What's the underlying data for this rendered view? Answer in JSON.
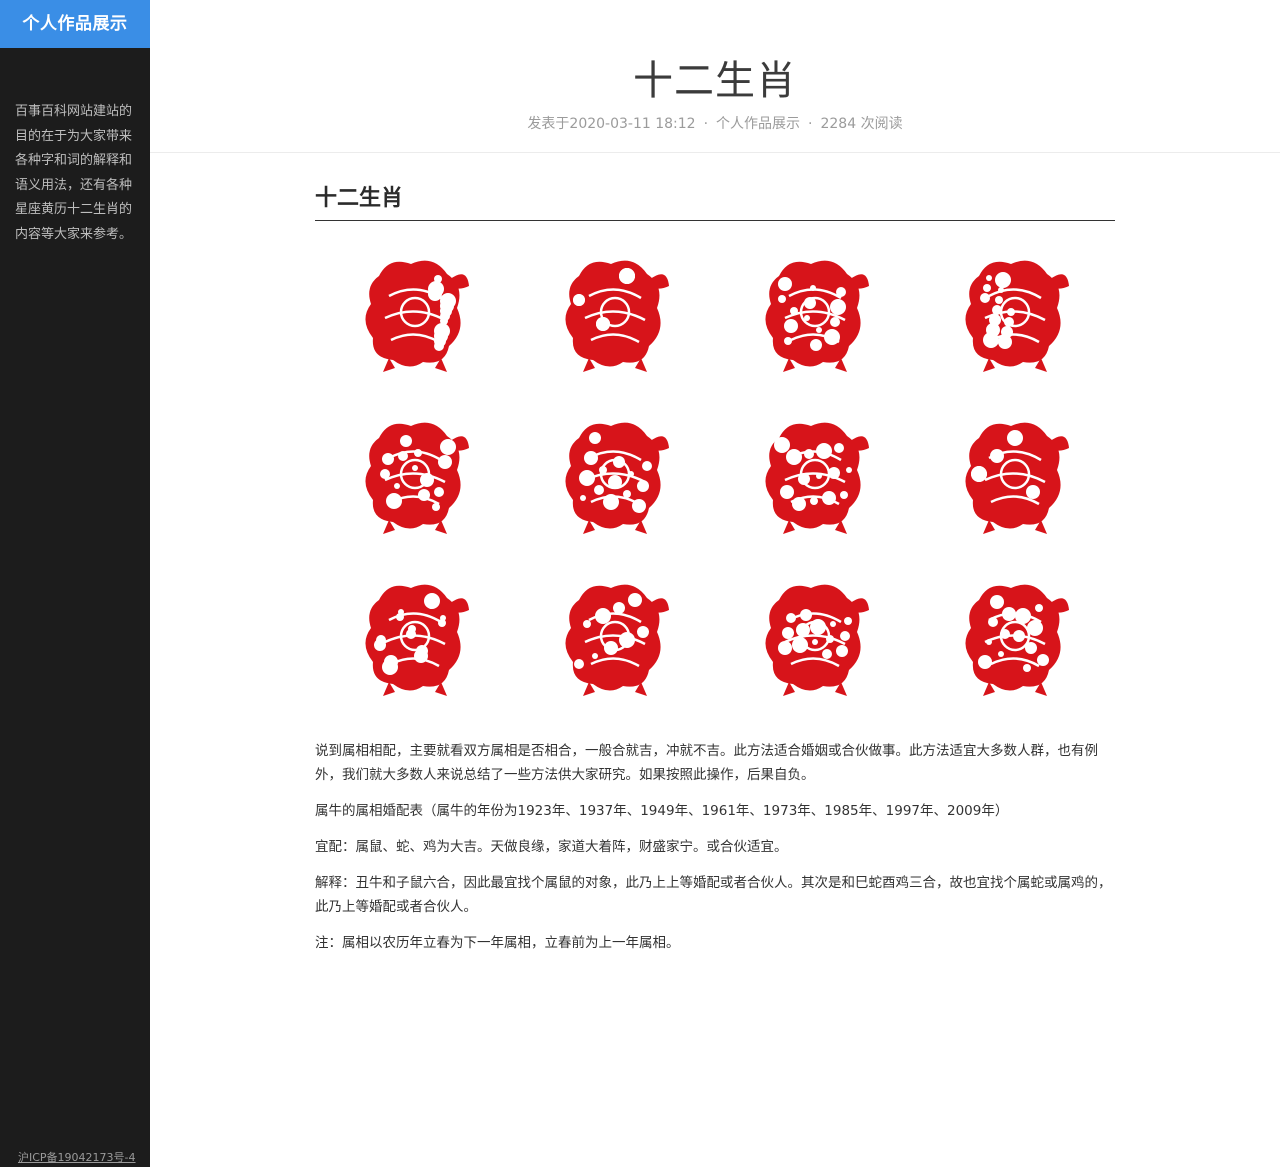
{
  "sidebar": {
    "brand": "个人作品展示",
    "description": "百事百科网站建站的目的在于为大家带来各种字和词的解释和语义用法，还有各种星座黄历十二生肖的内容等大家来参考。",
    "icp": "沪ICP备19042173号-4"
  },
  "header": {
    "title": "十二生肖",
    "meta": {
      "date": "发表于2020-03-11 18:12",
      "separator": "·",
      "category": "个人作品展示",
      "reads": "2284 次阅读"
    }
  },
  "content": {
    "heading": "十二生肖",
    "zodiac_images": [
      {
        "icon": "rat-papercut-icon"
      },
      {
        "icon": "ox-papercut-icon"
      },
      {
        "icon": "tiger-papercut-icon"
      },
      {
        "icon": "rabbit-papercut-icon"
      },
      {
        "icon": "dragon-papercut-icon"
      },
      {
        "icon": "snake-papercut-icon"
      },
      {
        "icon": "horse-papercut-icon"
      },
      {
        "icon": "goat-papercut-icon"
      },
      {
        "icon": "monkey-papercut-icon"
      },
      {
        "icon": "rooster-papercut-icon"
      },
      {
        "icon": "dog-papercut-icon"
      },
      {
        "icon": "pig-papercut-icon"
      }
    ],
    "paragraphs": [
      "说到属相相配，主要就看双方属相是否相合，一般合就吉，冲就不吉。此方法适合婚姻或合伙做事。此方法适宜大多数人群，也有例外，我们就大多数人来说总结了一些方法供大家研究。如果按照此操作，后果自负。",
      "属牛的属相婚配表（属牛的年份为1923年、1937年、1949年、1961年、1973年、1985年、1997年、2009年）",
      "宜配：属鼠、蛇、鸡为大吉。天做良缘，家道大着阵，财盛家宁。或合伙适宜。",
      "解释：丑牛和子鼠六合，因此最宜找个属鼠的对象，此乃上上等婚配或者合伙人。其次是和巳蛇酉鸡三合，故也宜找个属蛇或属鸡的，此乃上等婚配或者合伙人。",
      "注：属相以农历年立春为下一年属相，立春前为上一年属相。"
    ]
  },
  "colors": {
    "sidebar_bg": "#1c1c1c",
    "brand_bg": "#3a8ee6",
    "papercut_red": "#d7141a"
  }
}
